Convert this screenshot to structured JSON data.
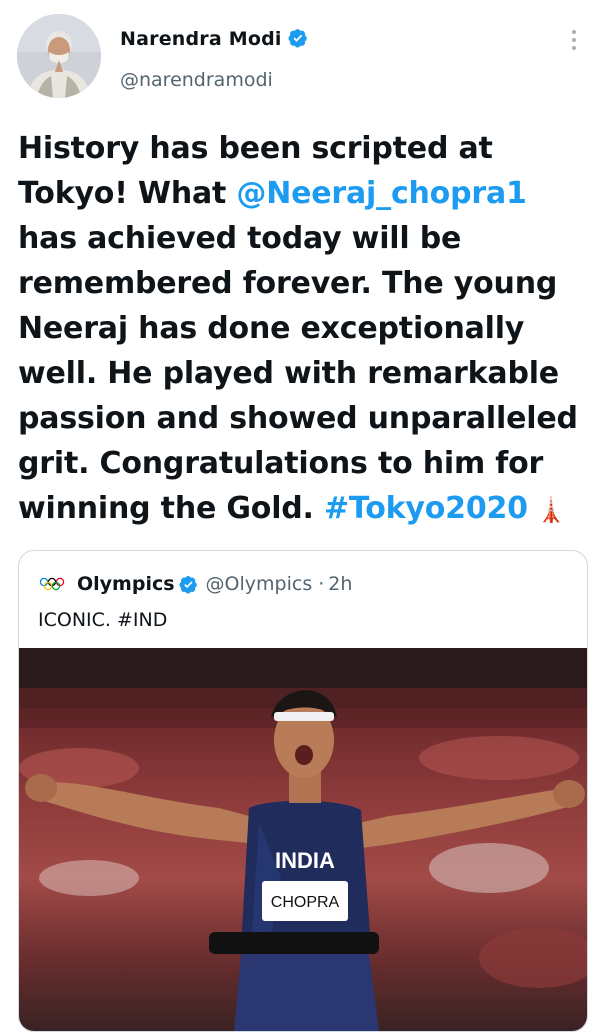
{
  "author": {
    "name": "Narendra Modi",
    "handle": "@narendramodi",
    "avatar_icon": "profile-photo",
    "verified": true
  },
  "tweet": {
    "lines": [
      [
        "History has been scripted at"
      ],
      [
        "Tokyo! What ",
        "@Neeraj_chopra1"
      ],
      [
        "has achieved today will be"
      ],
      [
        "remembered forever. The young"
      ],
      [
        "Neeraj has done exceptionally"
      ],
      [
        "well. He played with remarkable"
      ],
      [
        "passion and showed unparalleled"
      ],
      [
        "grit. Congratulations to him for"
      ],
      [
        "winning the Gold. ",
        "#Tokyo2020",
        " 🗼"
      ]
    ],
    "mention": "@Neeraj_chopra1",
    "hashtag": "#Tokyo2020",
    "emoji": "🗼"
  },
  "quote": {
    "name": "Olympics",
    "handle": "@Olympics",
    "separator": "·",
    "time": "2h",
    "text": "ICONIC. #IND",
    "media": {
      "description_icon": "athlete-celebration-photo",
      "bib_text": "CHOPRA",
      "jersey_text": "INDIA"
    }
  },
  "colors": {
    "link": "#1d9bf0",
    "verified": "#1d9bf0",
    "muted": "#536471",
    "border": "#cfd9de"
  }
}
